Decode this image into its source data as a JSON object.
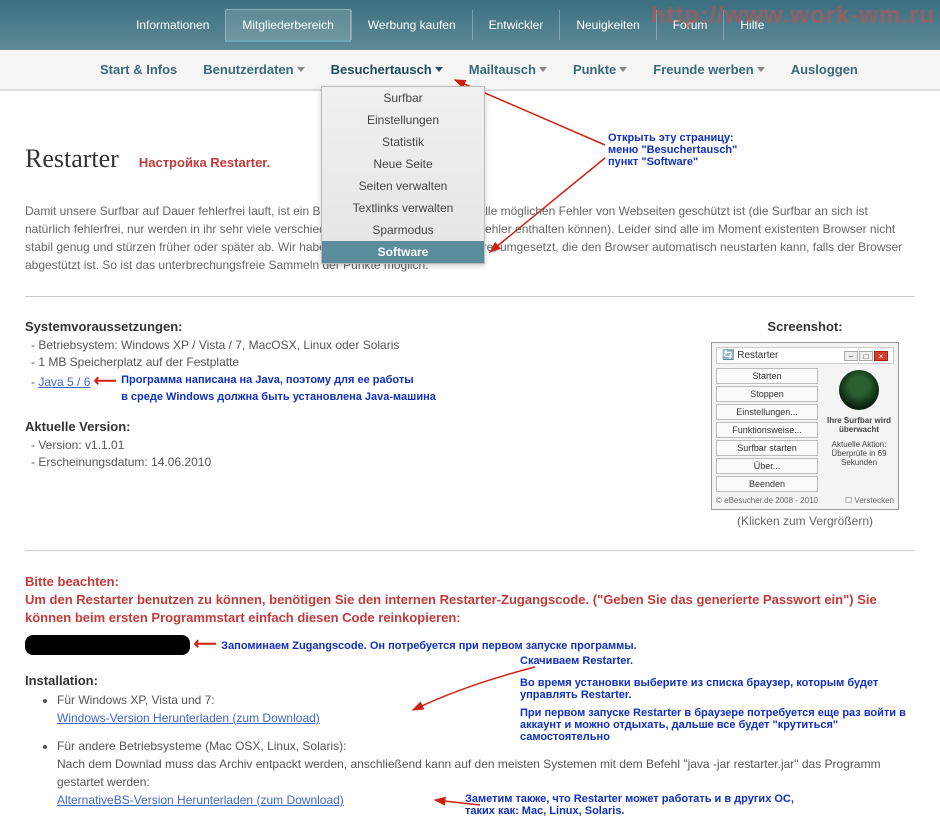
{
  "watermark": "http://www.work-wm.ru",
  "top_nav": {
    "items": [
      "Informationen",
      "Mitgliederbereich",
      "Werbung kaufen",
      "Entwickler",
      "Neuigkeiten",
      "Forum",
      "Hilfe"
    ],
    "active_index": 1
  },
  "sub_nav": {
    "items": [
      "Start & Infos",
      "Benutzerdaten",
      "Besuchertausch",
      "Mailtausch",
      "Punkte",
      "Freunde werben",
      "Ausloggen"
    ],
    "has_caret": [
      false,
      true,
      true,
      true,
      true,
      true,
      false
    ],
    "active_index": 2
  },
  "dropdown": {
    "items": [
      "Surfbar",
      "Einstellungen",
      "Statistik",
      "Neue Seite",
      "Seiten verwalten",
      "Textlinks verwalten",
      "Sparmodus",
      "Software"
    ],
    "selected_index": 7
  },
  "annot_menu": {
    "l1": "Открыть эту страницу:",
    "l2": "меню \"Besuchertausch\"",
    "l3": "пункт \"Software\""
  },
  "title": "Restarter",
  "subtitle": "Настройка Restarter.",
  "intro": "Damit unsere Surfbar auf Dauer fehlerfrei lauft, ist ein Browser notwendig, der gegen alle möglichen Fehler von Webseiten geschützt ist (die Surfbar an sich ist natürlich fehlerfrei, nur werden in ihr sehr viele verschiedene Webseiten geladen, die Fehler enthalten können). Leider sind alle im Moment existenten Browser nicht stabil genug und stürzen früher oder später ab. Wir haben daher eine spezielle Software, umgesetzt, die den Browser automatisch neustarten kann, falls der Browser abgestützt ist. So ist das unterbrechungsfreie Sammeln der Punkte möglich.",
  "sysreq": {
    "head": "Systemvoraussetzungen:",
    "l1": "- Betriebsystem: Windows XP / Vista / 7, MacOSX, Linux oder Solaris",
    "l2": "- 1 MB Speicherplatz auf der Festplatte",
    "l3_prefix": "- ",
    "l3_link": "Java 5 / 6"
  },
  "annot_java": {
    "l1": "Программа написана на Java, поэтому для ее работы",
    "l2": "в среде Windows должна быть установлена Java-машина"
  },
  "version": {
    "head": "Aktuelle Version:",
    "l1": "- Version: v1.1.01",
    "l2": "- Erscheinungsdatum: 14.06.2010"
  },
  "screenshot": {
    "head": "Screenshot:",
    "caption": "(Klicken zum Vergrößern)",
    "win_title": "Restarter",
    "buttons": [
      "Starten",
      "Stoppen",
      "Einstellungen...",
      "Funktionsweise...",
      "Surfbar starten",
      "Über...",
      "Beenden"
    ],
    "status1": "Ihre Surfbar wird überwacht",
    "status2_label": "Aktuelle Aktion:",
    "status2_val": "Überprüfe in 69 Sekunden",
    "footer_l": "© eBesucher.de 2008 - 2010",
    "footer_r": "Verstecken"
  },
  "notice": {
    "head": "Bitte beachten:",
    "body": "Um den Restarter benutzen zu können, benötigen Sie den internen Restarter-Zugangscode. (\"Geben Sie das generierte Passwort ein\") Sie können beim ersten Programmstart einfach diesen Code reinkopieren:"
  },
  "code_hidden": "●●●●●●●●●●●●●",
  "annot_code": "Запоминаем Zugangscode. Он потребуется при первом запуске программы.",
  "install": {
    "head": "Installation:",
    "win_label": "Für Windows XP, Vista und 7:",
    "win_link": "Windows-Version Herunterladen (zum Download)",
    "other_label": "Für andere Betriebsysteme (Mac OSX, Linux, Solaris):",
    "other_text": "Nach dem Downlad muss das Archiv entpackt werden, anschließend kann auf den meisten Systemen mit dem Befehl \"java -jar restarter.jar\" das Programm gestartet werden:",
    "alt_link": "AlternativeBS-Version Herunterladen (zum Download)"
  },
  "annot_dl": {
    "l1": "Скачиваем Restarter.",
    "l2": "Во время установки выберите из списка браузер, которым будет управлять Restarter.",
    "l3": "При первом запуске Restarter в браузере потребуется еще раз войти в аккаунт и можно отдыхать, дальше все будет \"крутиться\" самостоятельно"
  },
  "annot_alt": {
    "l1": "Заметим также, что Restarter может работать и в других ОС,",
    "l2": "таких как: Mac, Linux, Solaris."
  }
}
